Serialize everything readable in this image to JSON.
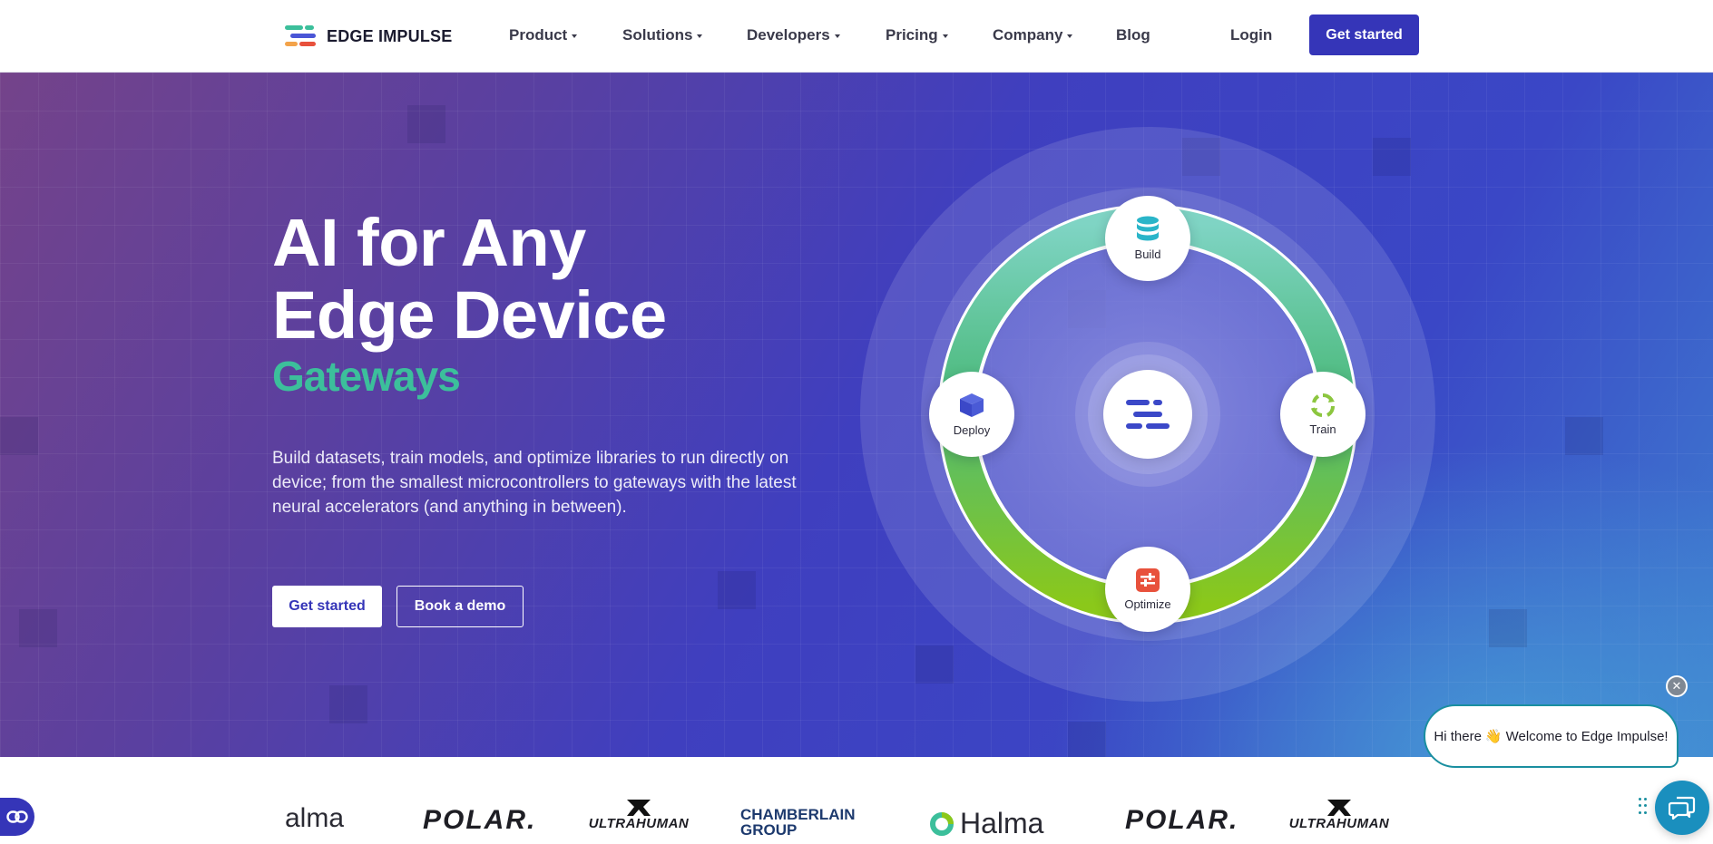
{
  "nav": {
    "logo_text": "EDGE IMPULSE",
    "items": [
      {
        "label": "Product"
      },
      {
        "label": "Solutions"
      },
      {
        "label": "Developers"
      },
      {
        "label": "Pricing"
      },
      {
        "label": "Company"
      },
      {
        "label": "Blog"
      }
    ],
    "login_label": "Login",
    "cta_label": "Get started"
  },
  "hero": {
    "title_line1": "AI for Any",
    "title_line2": "Edge Device",
    "accent": "Gateways",
    "description": "Build datasets, train models, and optimize libraries to run directly on device; from the smallest microcontrollers to gateways with the latest neural accelerators (and anything in between).",
    "primary_button": "Get started",
    "secondary_button": "Book a demo"
  },
  "cycle": {
    "nodes": [
      {
        "label": "Build",
        "icon": "database-icon"
      },
      {
        "label": "Train",
        "icon": "recycle-icon"
      },
      {
        "label": "Optimize",
        "icon": "sliders-icon"
      },
      {
        "label": "Deploy",
        "icon": "cube-icon"
      }
    ],
    "center_icon": "edge-impulse-logo-icon"
  },
  "chat": {
    "greeting_prefix": "Hi there",
    "greeting_emoji": "👋",
    "greeting_suffix": "Welcome to Edge Impulse!",
    "close_icon": "close-icon",
    "launcher_icon": "chat-icon"
  },
  "customer_logos": [
    {
      "name": "alma"
    },
    {
      "name": "POLAR."
    },
    {
      "name": "ULTRAHUMAN"
    },
    {
      "name_line1": "CHAMBERLAIN",
      "name_line2": "GROUP"
    },
    {
      "name": "Halma"
    },
    {
      "name": "POLAR."
    },
    {
      "name": "ULTRAHUMAN"
    }
  ],
  "colors": {
    "brand_blue": "#3535b8",
    "accent_green": "#3cbf9b",
    "chat_teal": "#1a8fa0"
  }
}
